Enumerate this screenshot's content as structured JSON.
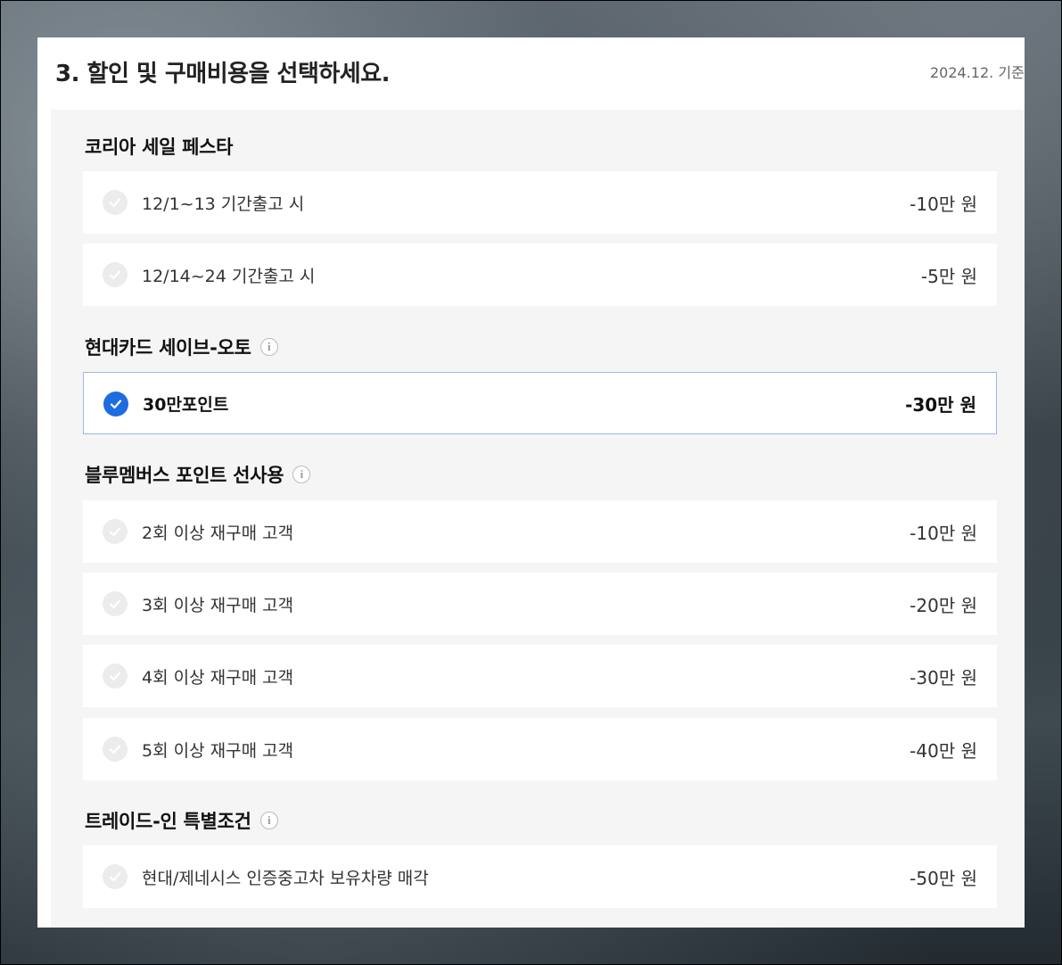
{
  "header": {
    "title": "3. 할인 및 구매비용을 선택하세요.",
    "date": "2024.12. 기준"
  },
  "colors": {
    "accent": "#1f6be0",
    "selected_border": "#9eb7e0",
    "unchecked": "#ececec",
    "section_bg": "#f5f5f5"
  },
  "groups": [
    {
      "title": "코리아 세일 페스타",
      "has_info": false,
      "options": [
        {
          "label": "12/1~13 기간출고 시",
          "price": "-10만 원",
          "selected": false
        },
        {
          "label": "12/14~24 기간출고 시",
          "price": "-5만 원",
          "selected": false
        }
      ]
    },
    {
      "title": "현대카드 세이브-오토",
      "has_info": true,
      "options": [
        {
          "label": "30만포인트",
          "price": "-30만 원",
          "selected": true
        }
      ]
    },
    {
      "title": "블루멤버스 포인트 선사용",
      "has_info": true,
      "options": [
        {
          "label": "2회 이상 재구매 고객",
          "price": "-10만 원",
          "selected": false
        },
        {
          "label": "3회 이상 재구매 고객",
          "price": "-20만 원",
          "selected": false
        },
        {
          "label": "4회 이상 재구매 고객",
          "price": "-30만 원",
          "selected": false
        },
        {
          "label": "5회 이상 재구매 고객",
          "price": "-40만 원",
          "selected": false
        }
      ]
    },
    {
      "title": "트레이드-인 특별조건",
      "has_info": true,
      "options": [
        {
          "label": "현대/제네시스 인증중고차 보유차량 매각",
          "price": "-50만 원",
          "selected": false
        }
      ]
    }
  ],
  "icons": {
    "check": "check-icon",
    "info": "info-icon"
  }
}
